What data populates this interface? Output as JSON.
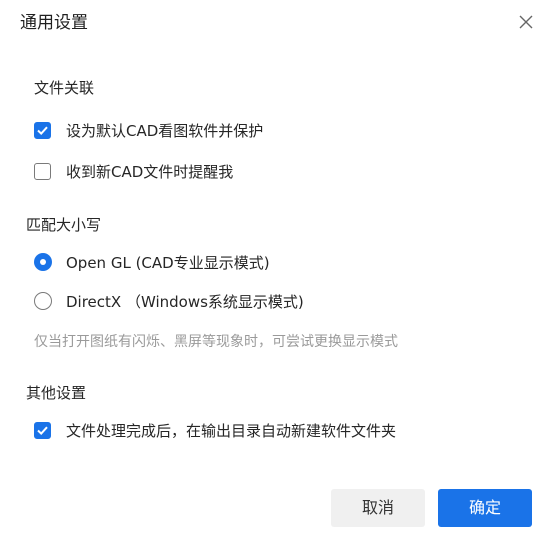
{
  "dialog": {
    "title": "通用设置",
    "close_icon": "close-icon"
  },
  "sections": {
    "file_association": {
      "heading": "文件关联",
      "options": [
        {
          "label": "设为默认CAD看图软件并保护",
          "checked": true
        },
        {
          "label": "收到新CAD文件时提醒我",
          "checked": false
        }
      ]
    },
    "renderer": {
      "heading": "匹配大小写",
      "options": [
        {
          "label": "Open GL (CAD专业显示模式)",
          "selected": true
        },
        {
          "label": "DirectX （Windows系统显示模式)",
          "selected": false
        }
      ],
      "hint": "仅当打开图纸有闪烁、黑屏等现象时，可尝试更换显示模式"
    },
    "other": {
      "heading": "其他设置",
      "options": [
        {
          "label": "文件处理完成后，在输出目录自动新建软件文件夹",
          "checked": true
        }
      ]
    }
  },
  "buttons": {
    "cancel": "取消",
    "confirm": "确定"
  },
  "colors": {
    "accent": "#1a73e8",
    "hint_text": "#9a9a9a"
  }
}
